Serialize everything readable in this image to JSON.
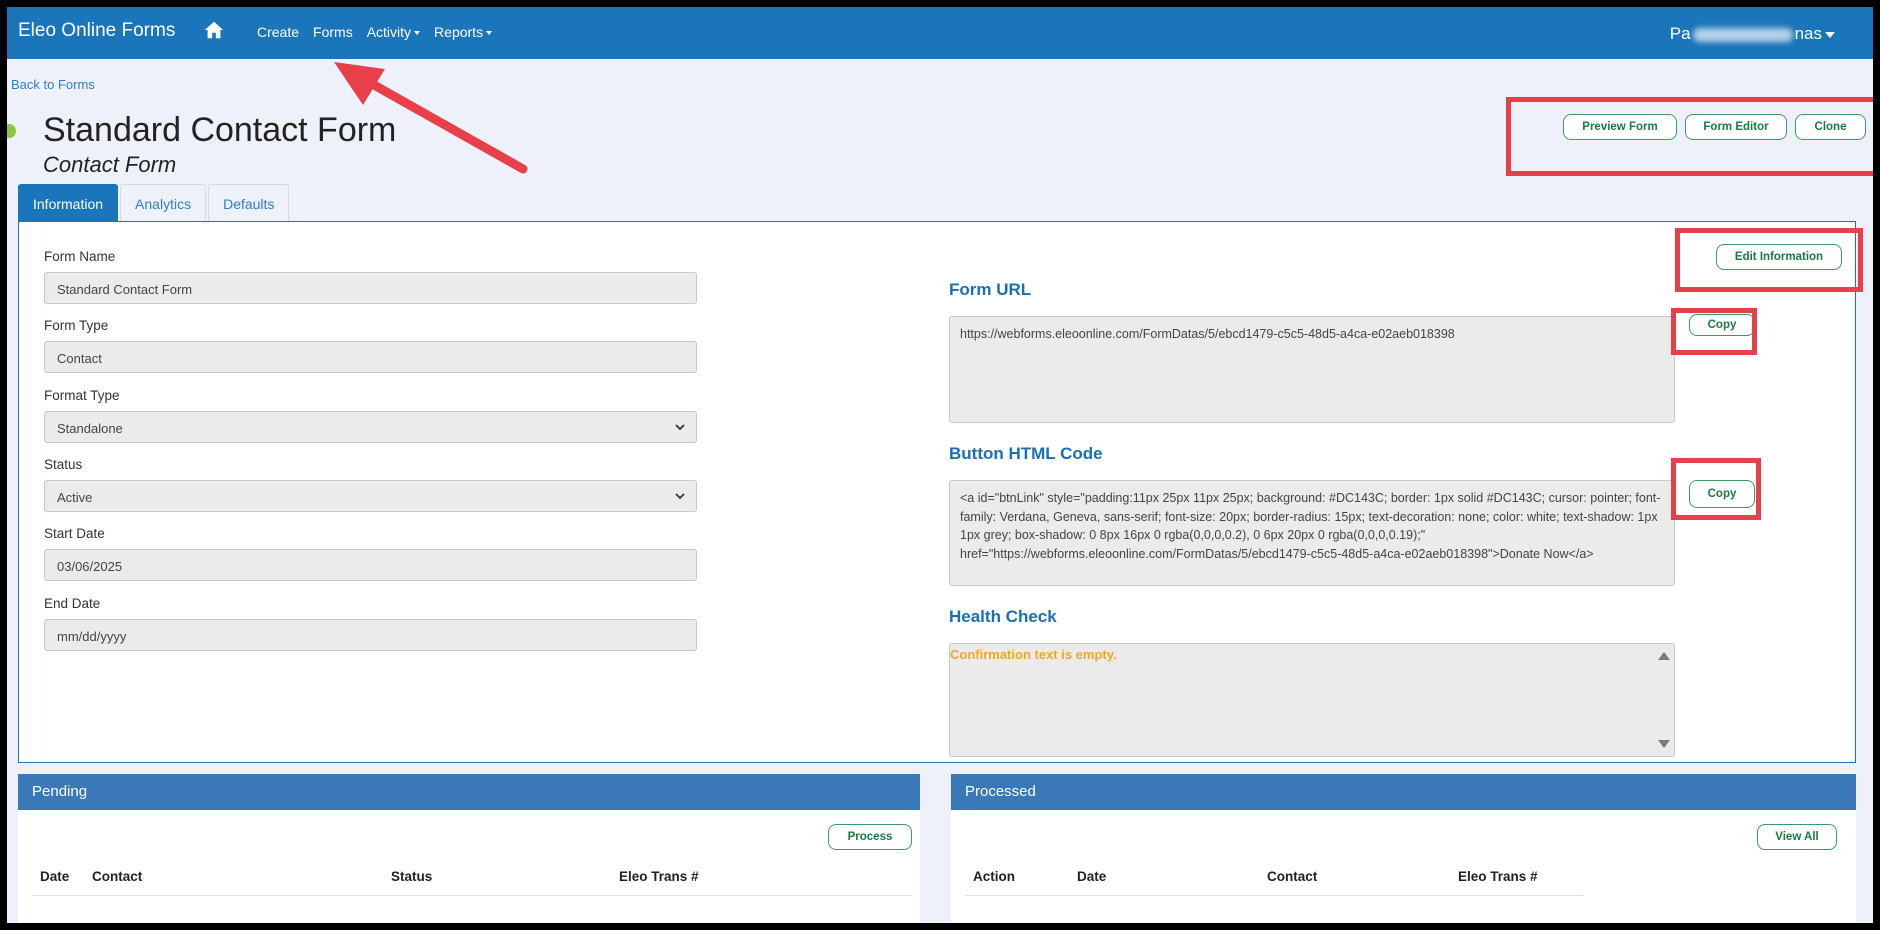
{
  "app": {
    "brand": "Eleo Online Forms",
    "nav": {
      "create": "Create",
      "forms": "Forms",
      "activity": "Activity",
      "reports": "Reports"
    },
    "user_left": "Pa",
    "user_right": "nas"
  },
  "page": {
    "back_link": "Back to Forms",
    "title": "Standard Contact Form",
    "subtitle": "Contact Form"
  },
  "actions": {
    "preview": "Preview Form",
    "editor": "Form Editor",
    "clone": "Clone"
  },
  "tabs": {
    "information": "Information",
    "analytics": "Analytics",
    "defaults": "Defaults"
  },
  "form": {
    "name_label": "Form Name",
    "name_value": "Standard Contact Form",
    "type_label": "Form Type",
    "type_value": "Contact",
    "format_label": "Format Type",
    "format_value": "Standalone",
    "status_label": "Status",
    "status_value": "Active",
    "start_label": "Start Date",
    "start_value": "03/06/2025",
    "end_label": "End Date",
    "end_placeholder": "mm/dd/yyyy"
  },
  "info": {
    "edit_button": "Edit Information",
    "url_heading": "Form URL",
    "url_value": "https://webforms.eleoonline.com/FormDatas/5/ebcd1479-c5c5-48d5-a4ca-e02aeb018398",
    "copy_label": "Copy",
    "html_heading": "Button HTML Code",
    "html_value": "<a id=\"btnLink\" style=\"padding:11px 25px 11px 25px; background: #DC143C; border: 1px solid #DC143C; cursor: pointer; font-family: Verdana, Geneva, sans-serif; font-size: 20px; border-radius: 15px;  text-decoration: none;  color: white; text-shadow: 1px 1px grey; box-shadow: 0 8px 16px 0 rgba(0,0,0,0.2), 0 6px 20px 0 rgba(0,0,0,0.19);\" href=\"https://webforms.eleoonline.com/FormDatas/5/ebcd1479-c5c5-48d5-a4ca-e02aeb018398\">Donate Now</a>",
    "health_heading": "Health Check",
    "health_warning": "Confirmation text is empty."
  },
  "pending": {
    "title": "Pending",
    "button": "Process",
    "columns": [
      "Date",
      "Contact",
      "Status",
      "Eleo Trans #"
    ]
  },
  "processed": {
    "title": "Processed",
    "button": "View All",
    "columns": [
      "Action",
      "Date",
      "Contact",
      "Eleo Trans #"
    ]
  },
  "colors": {
    "nav_blue": "#1b75bb",
    "panel_header_blue": "#3a78b8",
    "annotation_red": "#e8404a",
    "success_green": "#1a7a43",
    "warning_orange": "#f5a623",
    "status_dot_green": "#8dc63f"
  }
}
